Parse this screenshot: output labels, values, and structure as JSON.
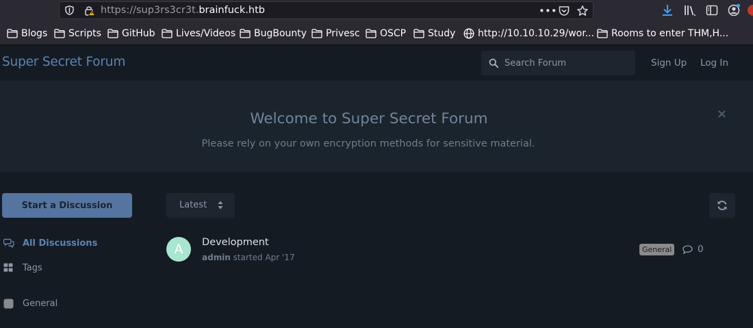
{
  "browser": {
    "url_scheme_and_sub": "https://sup3rs3cr3t.",
    "url_host": "brainfuck.htb",
    "bookmarks": [
      {
        "label": "Blogs"
      },
      {
        "label": "Scripts"
      },
      {
        "label": "GitHub"
      },
      {
        "label": "Lives/Videos"
      },
      {
        "label": "BugBounty"
      },
      {
        "label": "Privesc"
      },
      {
        "label": "OSCP"
      },
      {
        "label": "Study"
      },
      {
        "label": "http://10.10.10.29/wor..."
      },
      {
        "label": "Rooms to enter THM,H..."
      }
    ]
  },
  "header": {
    "brand": "Super Secret Forum",
    "search_placeholder": "Search Forum",
    "sign_up": "Sign Up",
    "log_in": "Log In"
  },
  "hero": {
    "title": "Welcome to Super Secret Forum",
    "subtitle": "Please rely on your own encryption methods for sensitive material.",
    "close_glyph": "×"
  },
  "sidebar": {
    "start_button": "Start a Discussion",
    "nav": [
      {
        "label": "All Discussions",
        "icon": "comments-icon",
        "active": true
      },
      {
        "label": "Tags",
        "icon": "th-large-icon",
        "active": false
      },
      {
        "label": "General",
        "icon": "tag-square-icon",
        "active": false
      }
    ]
  },
  "toolbar": {
    "sort_label": "Latest"
  },
  "discussions": [
    {
      "avatar_letter": "A",
      "title": "Development",
      "author": "admin",
      "meta": " started Apr '17",
      "tag": "General",
      "reply_count": "0"
    }
  ],
  "colors": {
    "background": "#151b23",
    "hero_background": "#1b232c",
    "accent": "#5b84b1",
    "primary_button": "#5674a0",
    "avatar": "#a8e6cf"
  }
}
